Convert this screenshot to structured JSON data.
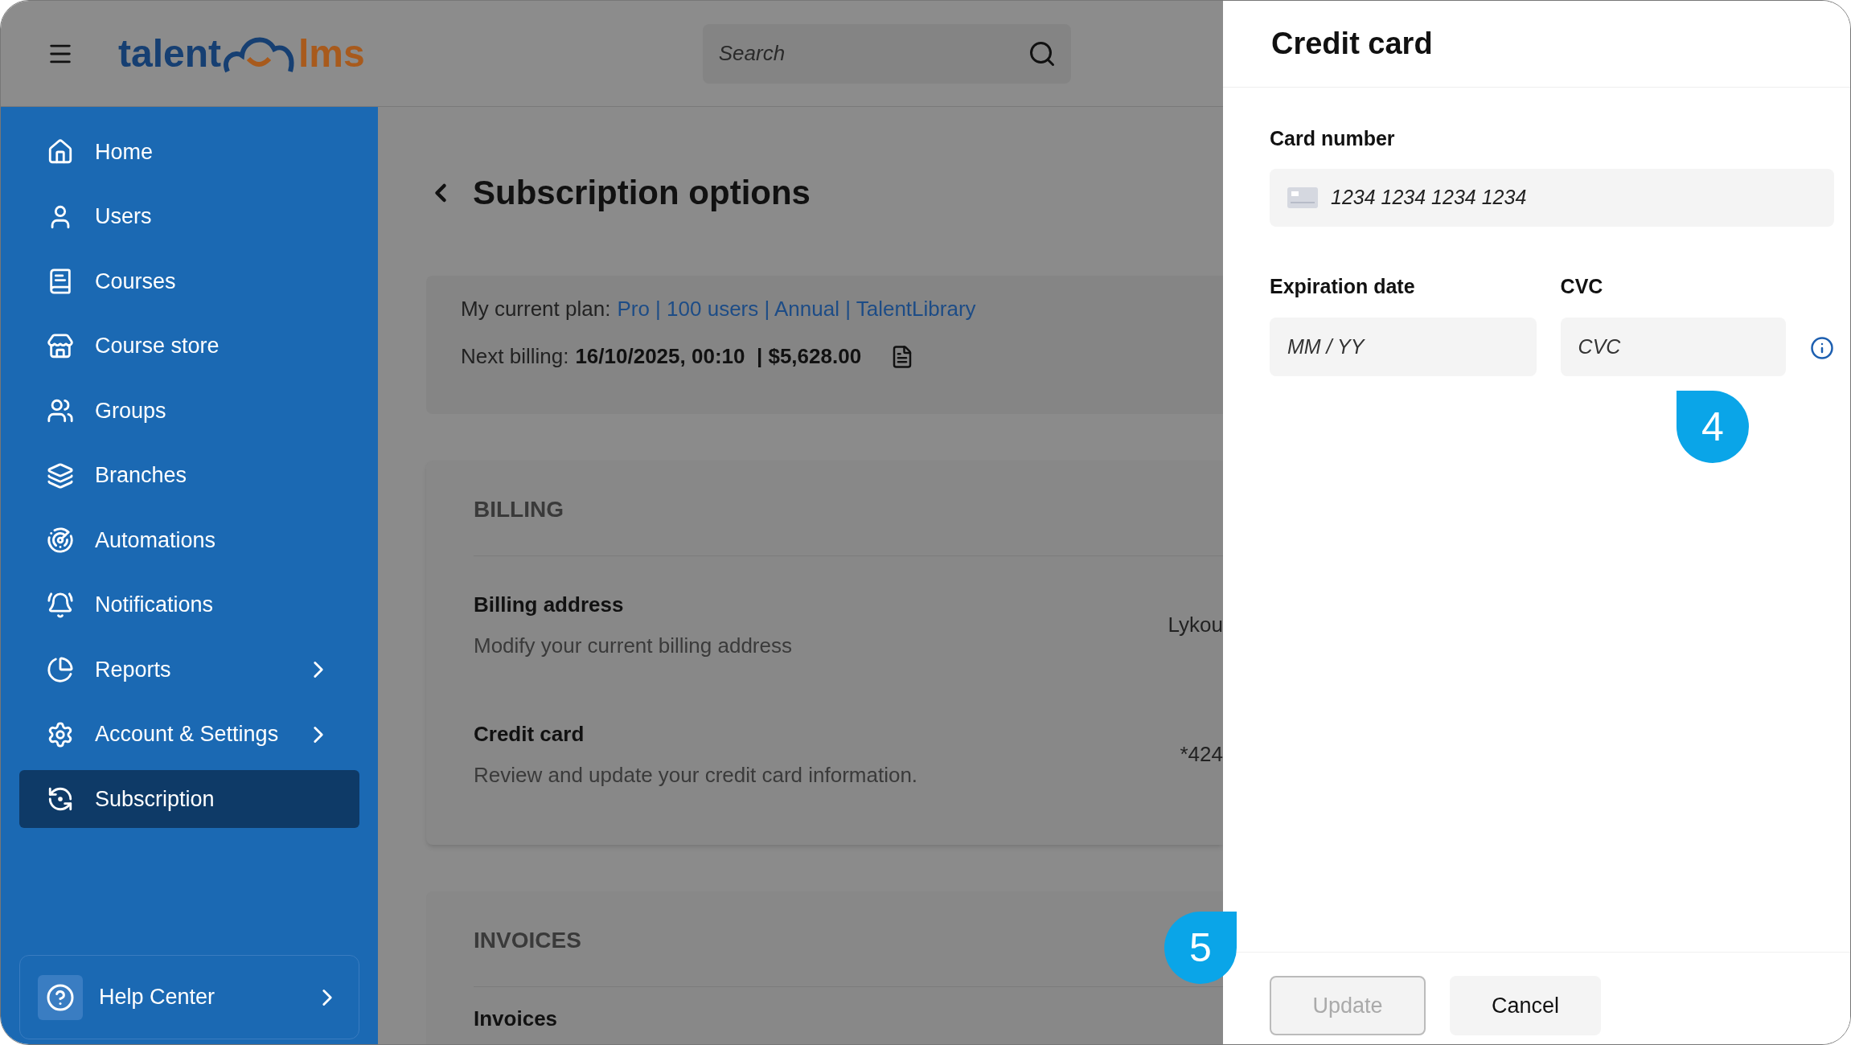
{
  "header": {
    "logo": {
      "left": "talent",
      "right": "lms"
    },
    "search": {
      "placeholder": "Search"
    }
  },
  "sidebar": {
    "items": [
      {
        "label": "Home",
        "selected": false,
        "has_submenu": false
      },
      {
        "label": "Users",
        "selected": false,
        "has_submenu": false
      },
      {
        "label": "Courses",
        "selected": false,
        "has_submenu": false
      },
      {
        "label": "Course store",
        "selected": false,
        "has_submenu": false
      },
      {
        "label": "Groups",
        "selected": false,
        "has_submenu": false
      },
      {
        "label": "Branches",
        "selected": false,
        "has_submenu": false
      },
      {
        "label": "Automations",
        "selected": false,
        "has_submenu": false
      },
      {
        "label": "Notifications",
        "selected": false,
        "has_submenu": false
      },
      {
        "label": "Reports",
        "selected": false,
        "has_submenu": true
      },
      {
        "label": "Account & Settings",
        "selected": false,
        "has_submenu": true
      },
      {
        "label": "Subscription",
        "selected": true,
        "has_submenu": false
      }
    ],
    "help": {
      "label": "Help Center"
    }
  },
  "main": {
    "title": "Subscription options",
    "plan": {
      "label": "My current plan:",
      "value": "Pro | 100 users | Annual | TalentLibrary",
      "billing_label": "Next billing:",
      "billing_value": "16/10/2025, 00:10  | $5,628.00"
    },
    "billing": {
      "heading": "BILLING",
      "rows": [
        {
          "title": "Billing address",
          "description": "Modify your current billing address",
          "value": "Lykou"
        },
        {
          "title": "Credit card",
          "description": "Review and update your credit card information.",
          "value": "*424"
        }
      ]
    },
    "invoices": {
      "heading": "INVOICES",
      "row_title": "Invoices"
    }
  },
  "drawer": {
    "title": "Credit card",
    "card_number": {
      "label": "Card number",
      "placeholder": "1234 1234 1234 1234"
    },
    "expiration": {
      "label": "Expiration date",
      "placeholder": "MM / YY"
    },
    "cvc": {
      "label": "CVC",
      "placeholder": "CVC"
    },
    "buttons": [
      {
        "label": "Update",
        "kind": "primary",
        "disabled": true
      },
      {
        "label": "Cancel",
        "kind": "secondary",
        "disabled": false
      }
    ]
  },
  "markers": [
    {
      "label": "4"
    },
    {
      "label": "5"
    }
  ]
}
